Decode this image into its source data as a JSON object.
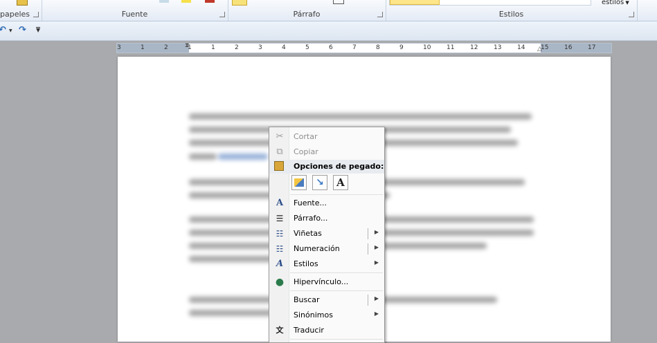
{
  "ribbon": {
    "groups": {
      "clipboard": "papeles",
      "font": "Fuente",
      "paragraph": "Párrafo",
      "styles": "Estilos"
    },
    "styles_change": "estilos"
  },
  "ruler": {
    "numbers": [
      "3",
      "1",
      "2",
      "1",
      "1",
      "2",
      "3",
      "4",
      "5",
      "6",
      "7",
      "8",
      "9",
      "10",
      "11",
      "12",
      "13",
      "14",
      "15",
      "16",
      "17"
    ]
  },
  "context_menu": {
    "cut": "Cortar",
    "copy": "Copiar",
    "paste_options": "Opciones de pegado:",
    "font": "Fuente...",
    "paragraph": "Párrafo...",
    "bullets": "Viñetas",
    "numbering": "Numeración",
    "styles": "Estilos",
    "hyperlink": "Hipervínculo...",
    "search": "Buscar",
    "synonyms": "Sinónimos",
    "translate": "Traducir"
  }
}
